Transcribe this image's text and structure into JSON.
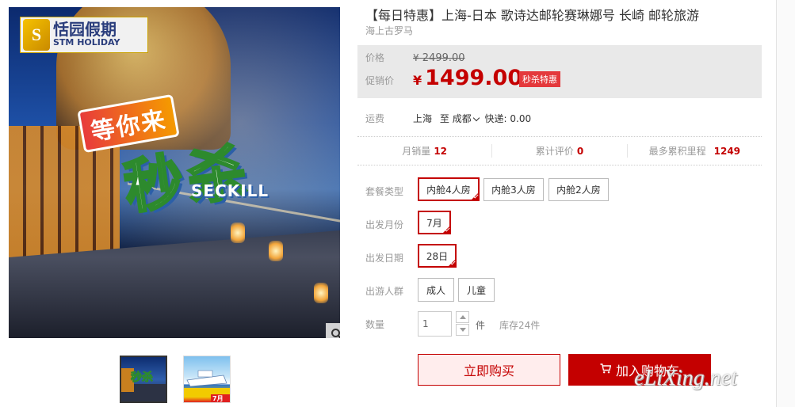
{
  "gallery": {
    "logo_cn": "恬园假期",
    "logo_en": "STM HOLIDAY",
    "promo_top": "等你来",
    "promo_main": "秒杀",
    "promo_en": "SECKILL",
    "thumb2_date": "7月28日"
  },
  "product": {
    "title": "【每日特惠】上海-日本 歌诗达邮轮赛琳娜号 长崎 邮轮旅游",
    "subtitle": "海上古罗马"
  },
  "price": {
    "label_original": "价格",
    "currency": "¥",
    "original": "2499.00",
    "label_sale": "促销价",
    "sale": "1499.00",
    "badge": "秒杀特惠"
  },
  "shipping": {
    "label": "运费",
    "from": "上海",
    "to_word": "至",
    "to": "成都",
    "method": "快递: 0.00"
  },
  "stats": {
    "monthly_sales_label": "月销量",
    "monthly_sales": "12",
    "reviews_label": "累计评价",
    "reviews": "0",
    "points_label": "最多累积里程",
    "points": "1249"
  },
  "options": {
    "package_label": "套餐类型",
    "packages": [
      "内舱4人房",
      "内舱3人房",
      "内舱2人房"
    ],
    "month_label": "出发月份",
    "month": "7月",
    "date_label": "出发日期",
    "date": "28日",
    "group_label": "出游人群",
    "groups": [
      "成人",
      "儿童"
    ]
  },
  "quantity": {
    "label": "数量",
    "value": "1",
    "unit": "件",
    "stock": "库存24件"
  },
  "actions": {
    "buy_now": "立即购买",
    "add_cart": "加入购物车"
  },
  "watermark": "eLiXing.net",
  "colors": {
    "accent": "#c40000",
    "price_bg": "#e9e9e9",
    "badge": "#e4393c"
  }
}
